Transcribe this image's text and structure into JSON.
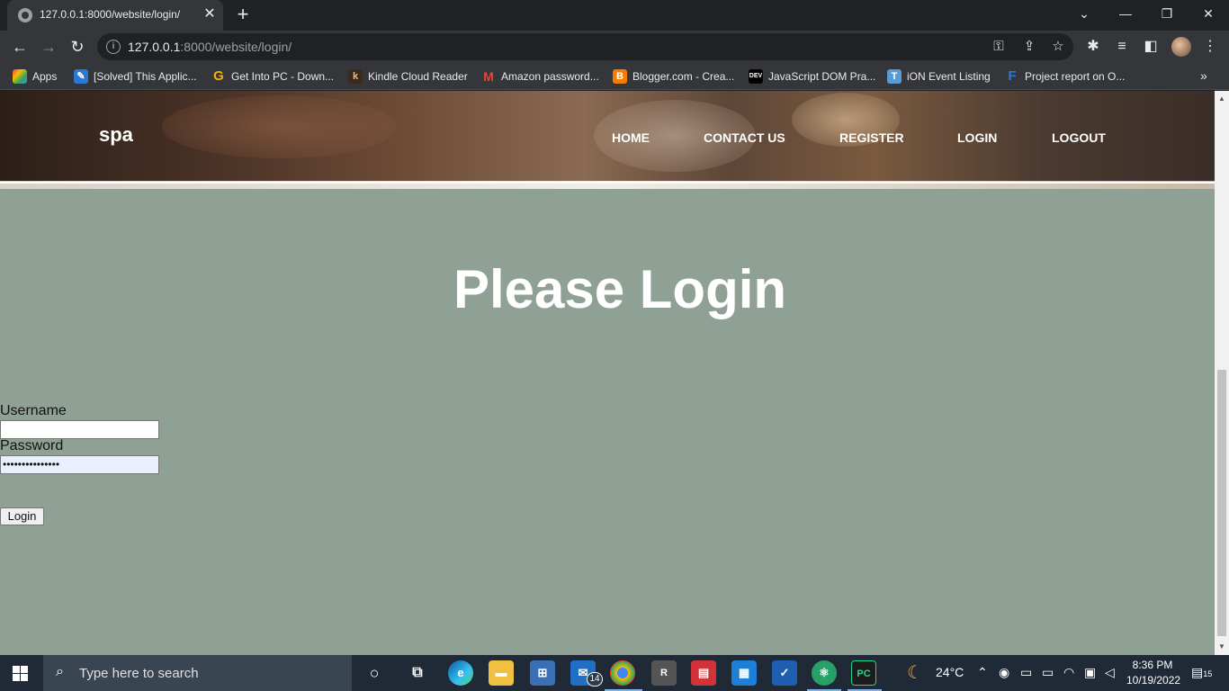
{
  "browser": {
    "tab_title": "127.0.0.1:8000/website/login/",
    "url_host": "127.0.0.1",
    "url_path": ":8000/website/login/",
    "new_tab_symbol": "+",
    "close_symbol": "✕"
  },
  "bookmarks": [
    {
      "label": "Apps",
      "icon": "apps-grid-icon"
    },
    {
      "label": "[Solved] This Applic...",
      "icon": "blue-puzzle-icon"
    },
    {
      "label": "Get Into PC - Down...",
      "icon": "g-logo-icon"
    },
    {
      "label": "Kindle Cloud Reader",
      "icon": "kindle-icon"
    },
    {
      "label": "Amazon password...",
      "icon": "gmail-icon"
    },
    {
      "label": "Blogger.com - Crea...",
      "icon": "blogger-icon"
    },
    {
      "label": "JavaScript DOM Pra...",
      "icon": "dev-icon"
    },
    {
      "label": "iON Event Listing",
      "icon": "tcs-icon"
    },
    {
      "label": "Project report on O...",
      "icon": "f-icon"
    }
  ],
  "site": {
    "brand": "spa",
    "nav": [
      "HOME",
      "CONTACT US",
      "REGISTER",
      "LOGIN",
      "LOGOUT"
    ]
  },
  "login": {
    "heading": "Please Login",
    "username_label": "Username",
    "username_value": "",
    "password_label": "Password",
    "password_value": "•••••••••••••••",
    "submit_label": "Login"
  },
  "taskbar": {
    "search_placeholder": "Type here to search",
    "weather": "24°C",
    "time": "8:36 PM",
    "date": "10/19/2022",
    "mail_badge": "14",
    "notification_count": "15"
  }
}
